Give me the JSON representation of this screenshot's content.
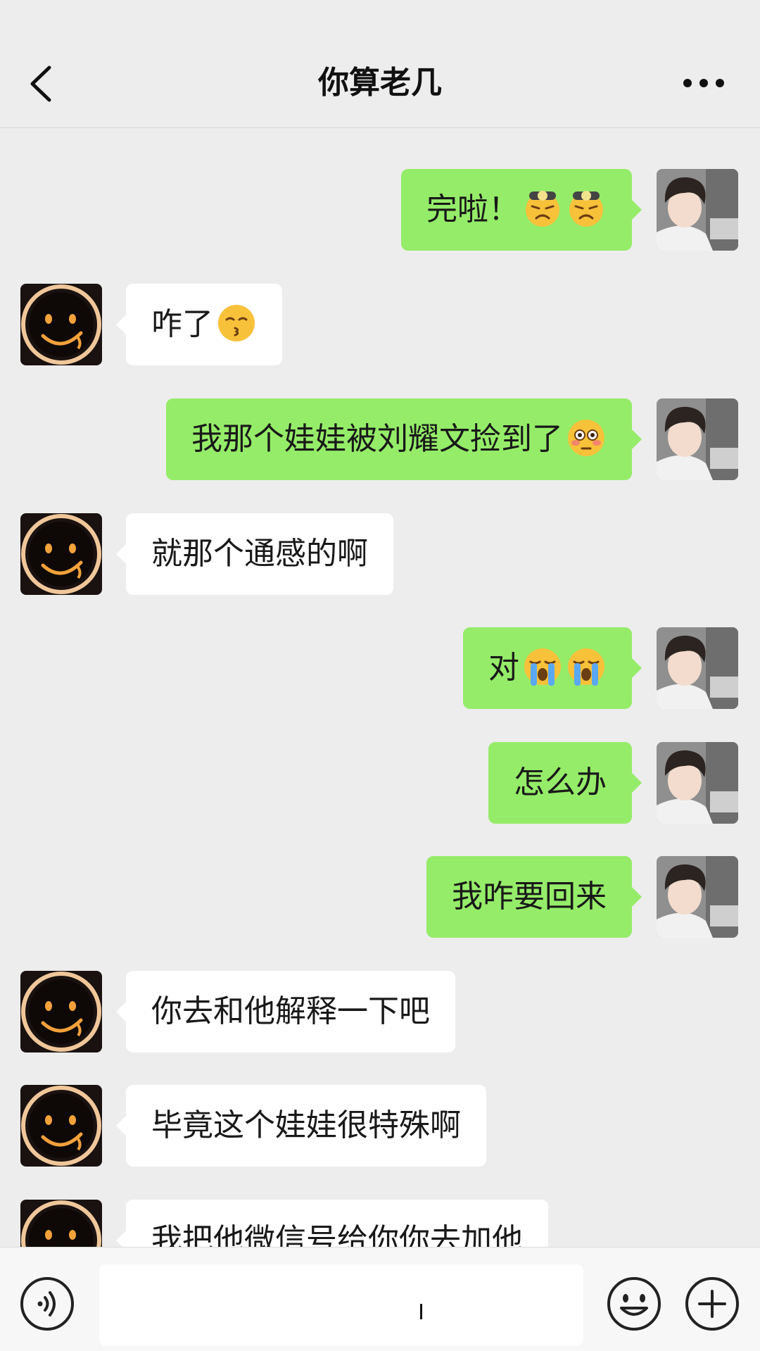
{
  "header": {
    "title": "你算老几",
    "back_icon": "chevron-left-icon",
    "more_icon": "more-dots-icon"
  },
  "messages": [
    {
      "side": "right",
      "text": "完啦！",
      "emoji": [
        "tired-face-emoji",
        "tired-face-emoji"
      ]
    },
    {
      "side": "left",
      "text": "咋了",
      "emoji": [
        "kissing-face-emoji"
      ]
    },
    {
      "side": "right",
      "text": "我那个娃娃被刘耀文捡到了",
      "emoji": [
        "flushed-face-emoji"
      ]
    },
    {
      "side": "left",
      "text": "就那个通感的啊",
      "emoji": []
    },
    {
      "side": "right",
      "text": "对",
      "emoji": [
        "crying-face-emoji",
        "crying-face-emoji"
      ]
    },
    {
      "side": "right",
      "text": "怎么办",
      "emoji": []
    },
    {
      "side": "right",
      "text": "我咋要回来",
      "emoji": []
    },
    {
      "side": "left",
      "text": "你去和他解释一下吧",
      "emoji": []
    },
    {
      "side": "left",
      "text": "毕竟这个娃娃很特殊啊",
      "emoji": []
    },
    {
      "side": "left",
      "text": "我把他微信号给你你去加他",
      "emoji": []
    }
  ],
  "input": {
    "value": "",
    "voice_icon": "voice-icon",
    "emoji_icon": "emoji-icon",
    "plus_icon": "plus-icon"
  },
  "colors": {
    "background": "#ededed",
    "sent_bubble": "#95ec69",
    "received_bubble": "#ffffff"
  }
}
